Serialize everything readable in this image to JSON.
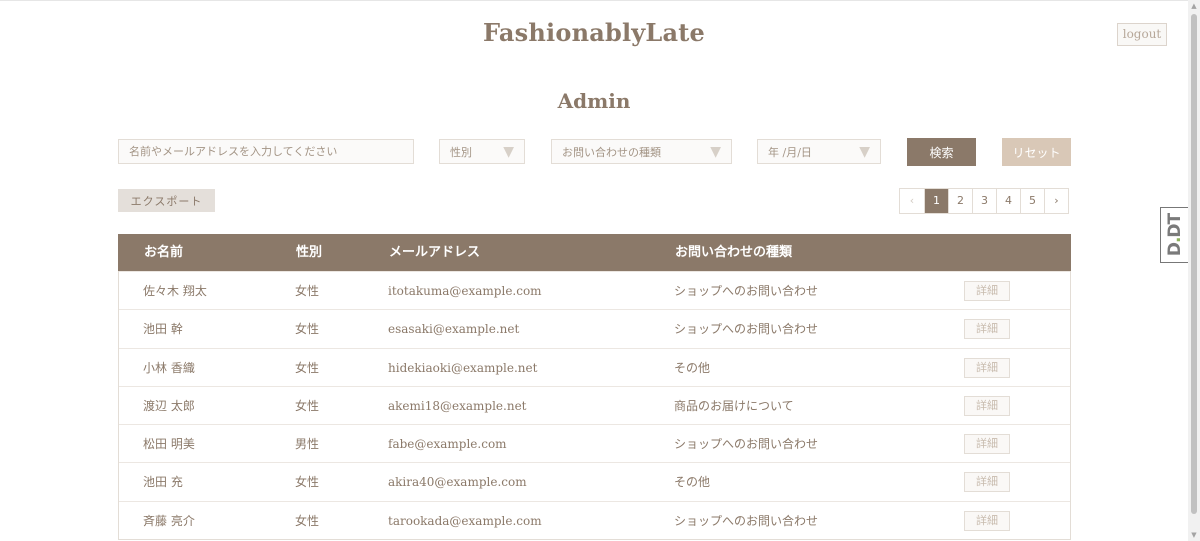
{
  "header": {
    "brand": "FashionablyLate",
    "logout_label": "logout",
    "page_title": "Admin"
  },
  "filters": {
    "search_placeholder": "名前やメールアドレスを入力してください",
    "gender_label": "性別",
    "category_label": "お問い合わせの種類",
    "date_label": "年 /月/日",
    "search_button": "検索",
    "reset_button": "リセット"
  },
  "toolbar": {
    "export_label": "エクスポート"
  },
  "pagination": {
    "prev": "‹",
    "next": "›",
    "pages": [
      "1",
      "2",
      "3",
      "4",
      "5"
    ],
    "current": "1"
  },
  "table": {
    "columns": [
      "お名前",
      "性別",
      "メールアドレス",
      "お問い合わせの種類"
    ],
    "detail_label": "詳細",
    "rows": [
      {
        "name": "佐々木 翔太",
        "gender": "女性",
        "email": "itotakuma@example.com",
        "category": "ショップへのお問い合わせ"
      },
      {
        "name": "池田 幹",
        "gender": "女性",
        "email": "esasaki@example.net",
        "category": "ショップへのお問い合わせ"
      },
      {
        "name": "小林 香織",
        "gender": "女性",
        "email": "hidekiaoki@example.net",
        "category": "その他"
      },
      {
        "name": "渡辺 太郎",
        "gender": "女性",
        "email": "akemi18@example.net",
        "category": "商品のお届けについて"
      },
      {
        "name": "松田 明美",
        "gender": "男性",
        "email": "fabe@example.com",
        "category": "ショップへのお問い合わせ"
      },
      {
        "name": "池田 充",
        "gender": "女性",
        "email": "akira40@example.com",
        "category": "その他"
      },
      {
        "name": "斉藤 亮介",
        "gender": "女性",
        "email": "tarookada@example.com",
        "category": "ショップへのお問い合わせ"
      }
    ]
  },
  "side_badge": {
    "text_dark": "D",
    "text_green": ".",
    "text_rest": "DT"
  },
  "colors": {
    "brand": "#8b7969",
    "reset": "#d9c8b7",
    "export_bg": "#e4dfda"
  }
}
